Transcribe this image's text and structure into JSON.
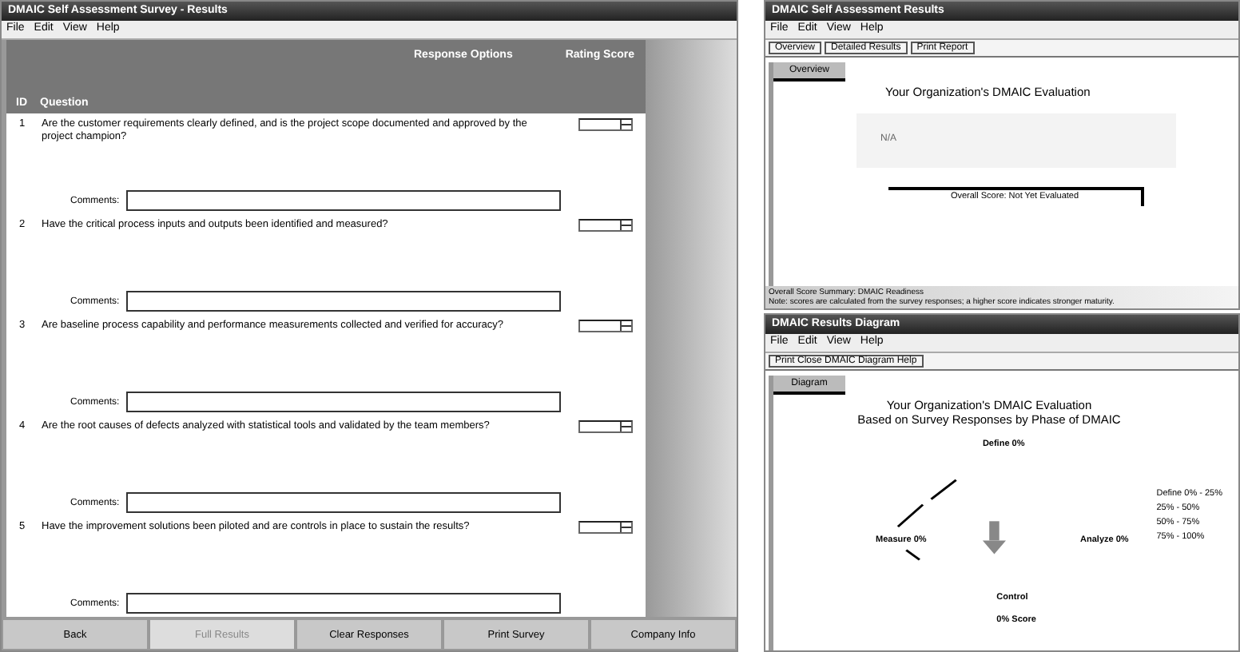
{
  "survey_window": {
    "title": "DMAIC Self Assessment Survey - Results",
    "menu": [
      "File",
      "Edit",
      "View",
      "Help"
    ],
    "columns": [
      "ID",
      "Question",
      "Response Options",
      "Rating Score"
    ],
    "questions": [
      {
        "number": "1",
        "text": "Are the customer requirements clearly defined, and is the project scope documented and approved by the project champion?",
        "comment_label": "Comments:"
      },
      {
        "number": "2",
        "text": "Have the critical process inputs and outputs been identified and measured?",
        "comment_label": "Comments:"
      },
      {
        "number": "3",
        "text": "Are baseline process capability and performance measurements collected and verified for accuracy?",
        "comment_label": "Comments:"
      },
      {
        "number": "4",
        "text": "Are the root causes of defects analyzed with statistical tools and validated by the team members?",
        "comment_label": "Comments:"
      },
      {
        "number": "5",
        "text": "Have the improvement solutions been piloted and are controls in place to sustain the results?",
        "comment_label": "Comments:"
      }
    ],
    "buttons": [
      {
        "label": "Back",
        "disabled": false
      },
      {
        "label": "Full Results",
        "disabled": true
      },
      {
        "label": "Clear Responses",
        "disabled": false
      },
      {
        "label": "Print Survey",
        "disabled": false
      },
      {
        "label": "Company Info",
        "disabled": false
      }
    ]
  },
  "overview_window": {
    "title": "DMAIC Self Assessment Results",
    "menu": [
      "File",
      "Edit",
      "View",
      "Help"
    ],
    "toolbar": [
      "Overview",
      "Detailed Results",
      "Print Report"
    ],
    "tab": "Overview",
    "heading": "Your Organization's DMAIC Evaluation",
    "panel_text": "N/A",
    "scale_label": "Overall Score: Not Yet Evaluated",
    "status": [
      "Overall Score Summary: DMAIC Readiness",
      "Note: scores are calculated from the survey responses; a higher score indicates stronger maturity."
    ]
  },
  "diagram_window": {
    "title": "DMAIC Results Diagram",
    "menu": [
      "File",
      "Edit",
      "View",
      "Help"
    ],
    "toolbar": "Print  Close  DMAIC Diagram  Help",
    "tab": "Diagram",
    "heading": [
      "Your Organization's DMAIC Evaluation",
      "Based on Survey Responses by Phase of DMAIC"
    ],
    "nodes": [
      {
        "kind": "top",
        "label": "Define 0%"
      },
      {
        "kind": "left",
        "label": "Measure 0%"
      },
      {
        "kind": "right",
        "label": "Analyze 0%"
      },
      {
        "kind": "bottom",
        "label": "Control"
      },
      {
        "kind": "bottom2",
        "label": "0% Score"
      }
    ],
    "legend": [
      "Define 0% - 25%",
      "25% - 50%",
      "50% - 75%",
      "75% - 100%"
    ]
  }
}
